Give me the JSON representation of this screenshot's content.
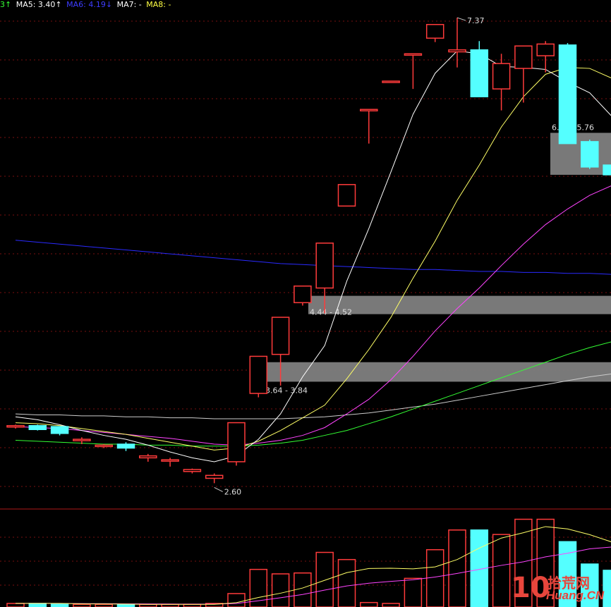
{
  "legend": {
    "prefix": "3↑",
    "ma5": "MA5: 3.40↑",
    "ma6": "MA6: 4.19↓",
    "ma7": "MA7: -",
    "ma8": "MA8: -"
  },
  "colors": {
    "up": "#ff3b3b",
    "down": "#54ffff",
    "ma5": "#ffffff",
    "ma10": "#ffff66",
    "ma20": "#ff44ff",
    "ma60": "#33ff33",
    "ma120": "#cccccc",
    "ma250": "#2a2aff",
    "zone": "#808080",
    "grid": "#7a1010"
  },
  "chart_data": {
    "type": "candlestick",
    "candles": [
      {
        "o": 3.18,
        "h": 3.2,
        "l": 3.16,
        "c": 3.19,
        "v": 0.4
      },
      {
        "o": 3.19,
        "h": 3.2,
        "l": 3.14,
        "c": 3.15,
        "v": 0.4
      },
      {
        "o": 3.18,
        "h": 3.18,
        "l": 3.09,
        "c": 3.11,
        "v": 0.3
      },
      {
        "o": 3.05,
        "h": 3.07,
        "l": 3.0,
        "c": 3.05,
        "v": 0.3
      },
      {
        "o": 2.99,
        "h": 3.0,
        "l": 2.96,
        "c": 2.99,
        "v": 0.3
      },
      {
        "o": 3.0,
        "h": 3.02,
        "l": 2.93,
        "c": 2.96,
        "v": 0.3
      },
      {
        "o": 2.86,
        "h": 2.9,
        "l": 2.82,
        "c": 2.88,
        "v": 0.3
      },
      {
        "o": 2.84,
        "h": 2.86,
        "l": 2.77,
        "c": 2.84,
        "v": 0.3
      },
      {
        "o": 2.72,
        "h": 2.75,
        "l": 2.7,
        "c": 2.74,
        "v": 0.3
      },
      {
        "o": 2.65,
        "h": 2.7,
        "l": 2.6,
        "c": 2.68,
        "v": 0.4
      },
      {
        "o": 2.82,
        "h": 3.22,
        "l": 2.78,
        "c": 3.22,
        "v": 1.5
      },
      {
        "o": 3.52,
        "h": 3.9,
        "l": 3.48,
        "c": 3.9,
        "v": 4.2
      },
      {
        "o": 3.92,
        "h": 4.3,
        "l": 3.6,
        "c": 4.3,
        "v": 3.7
      },
      {
        "o": 4.45,
        "h": 4.62,
        "l": 4.42,
        "c": 4.62,
        "v": 3.8
      },
      {
        "o": 4.6,
        "h": 5.06,
        "l": 4.34,
        "c": 5.06,
        "v": 6.1
      },
      {
        "o": 5.44,
        "h": 5.66,
        "l": 5.44,
        "c": 5.66,
        "v": 5.3
      },
      {
        "o": 6.43,
        "h": 6.43,
        "l": 6.08,
        "c": 6.43,
        "v": 0.5
      },
      {
        "o": 6.72,
        "h": 6.72,
        "l": 6.72,
        "c": 6.72,
        "v": 0.4
      },
      {
        "o": 7.0,
        "h": 7.0,
        "l": 6.64,
        "c": 7.0,
        "v": 3.2
      },
      {
        "o": 7.16,
        "h": 7.3,
        "l": 7.12,
        "c": 7.3,
        "v": 6.4
      },
      {
        "o": 7.02,
        "h": 7.37,
        "l": 6.86,
        "c": 7.04,
        "v": 8.6
      },
      {
        "o": 7.04,
        "h": 7.13,
        "l": 6.56,
        "c": 6.56,
        "v": 8.6
      },
      {
        "o": 6.64,
        "h": 7.0,
        "l": 6.42,
        "c": 6.9,
        "v": 8.1
      },
      {
        "o": 6.85,
        "h": 7.08,
        "l": 6.5,
        "c": 7.08,
        "v": 9.8
      },
      {
        "o": 6.98,
        "h": 7.13,
        "l": 6.81,
        "c": 7.1,
        "v": 9.8
      },
      {
        "o": 7.09,
        "h": 7.11,
        "l": 6.08,
        "c": 6.08,
        "v": 7.3
      },
      {
        "o": 6.1,
        "h": 6.12,
        "l": 5.82,
        "c": 5.84,
        "v": 4.8
      },
      {
        "o": 5.86,
        "h": 5.9,
        "l": 5.74,
        "c": 5.76,
        "v": 4.1
      },
      {
        "o": 5.71,
        "h": 5.79,
        "l": 5.68,
        "c": 5.78,
        "v": 3.2
      }
    ],
    "ma5": [
      3.28,
      3.25,
      3.2,
      3.14,
      3.09,
      3.05,
      2.99,
      2.92,
      2.86,
      2.82,
      2.88,
      3.05,
      3.31,
      3.69,
      4.01,
      4.67,
      5.21,
      5.79,
      6.38,
      6.8,
      7.03,
      7.0,
      6.87,
      6.86,
      6.84,
      6.71,
      6.6,
      6.36,
      6.02
    ],
    "ma10": [
      3.22,
      3.21,
      3.19,
      3.16,
      3.13,
      3.1,
      3.06,
      3.02,
      2.98,
      2.94,
      2.96,
      3.03,
      3.14,
      3.27,
      3.4,
      3.67,
      3.97,
      4.3,
      4.7,
      5.08,
      5.5,
      5.86,
      6.25,
      6.56,
      6.79,
      6.86,
      6.85,
      6.75,
      6.62
    ],
    "ma20": [
      3.18,
      3.17,
      3.16,
      3.14,
      3.12,
      3.1,
      3.08,
      3.06,
      3.03,
      3.0,
      2.99,
      3.01,
      3.04,
      3.09,
      3.17,
      3.31,
      3.46,
      3.66,
      3.9,
      4.16,
      4.39,
      4.6,
      4.83,
      5.05,
      5.25,
      5.41,
      5.55,
      5.65,
      5.74
    ],
    "ma60": [
      3.04,
      3.03,
      3.02,
      3.01,
      3.0,
      3.0,
      2.99,
      2.99,
      2.98,
      2.98,
      2.98,
      2.99,
      3.01,
      3.04,
      3.09,
      3.14,
      3.21,
      3.28,
      3.36,
      3.44,
      3.52,
      3.6,
      3.68,
      3.76,
      3.84,
      3.92,
      3.99,
      4.05,
      4.1
    ],
    "ma120": [
      3.31,
      3.3,
      3.3,
      3.29,
      3.29,
      3.28,
      3.28,
      3.27,
      3.27,
      3.26,
      3.26,
      3.26,
      3.26,
      3.27,
      3.28,
      3.3,
      3.32,
      3.35,
      3.38,
      3.41,
      3.45,
      3.49,
      3.53,
      3.57,
      3.61,
      3.65,
      3.69,
      3.72,
      3.75
    ],
    "ma250": [
      5.09,
      5.07,
      5.05,
      5.03,
      5.01,
      4.99,
      4.97,
      4.95,
      4.93,
      4.91,
      4.89,
      4.87,
      4.85,
      4.84,
      4.83,
      4.82,
      4.81,
      4.8,
      4.79,
      4.79,
      4.78,
      4.77,
      4.77,
      4.76,
      4.76,
      4.75,
      4.75,
      4.74,
      4.74
    ],
    "vol_ma1": [
      0.4,
      0.4,
      0.4,
      0.35,
      0.34,
      0.32,
      0.3,
      0.3,
      0.3,
      0.3,
      0.48,
      1.06,
      1.54,
      2.12,
      2.98,
      3.84,
      4.3,
      4.33,
      4.26,
      4.48,
      5.3,
      6.58,
      7.7,
      8.3,
      8.98,
      8.72,
      8.08,
      7.26,
      6.0
    ],
    "vol_ma2": [
      0.4,
      0.4,
      0.4,
      0.38,
      0.37,
      0.35,
      0.34,
      0.33,
      0.32,
      0.32,
      0.39,
      0.7,
      1.03,
      1.4,
      1.89,
      2.35,
      2.66,
      2.86,
      3.04,
      3.35,
      3.75,
      4.2,
      4.65,
      5.05,
      5.6,
      6.0,
      6.5,
      6.7,
      6.8
    ],
    "zones": [
      {
        "label": "4.44 - 4.52",
        "low": 4.44,
        "high": 4.52
      },
      {
        "label": "3.64 - 3.84",
        "low": 3.64,
        "high": 3.84
      },
      {
        "label": "6.19 - 5.76",
        "low": 5.76,
        "high": 6.19
      }
    ],
    "annotations": {
      "high": "7.37",
      "low": "2.60"
    },
    "price_range": [
      2.35,
      7.45
    ],
    "volume_max": 10.0,
    "grid": true
  },
  "watermark": {
    "number": "10",
    "cn": "拾荒网",
    "en": "Huang.CN"
  }
}
